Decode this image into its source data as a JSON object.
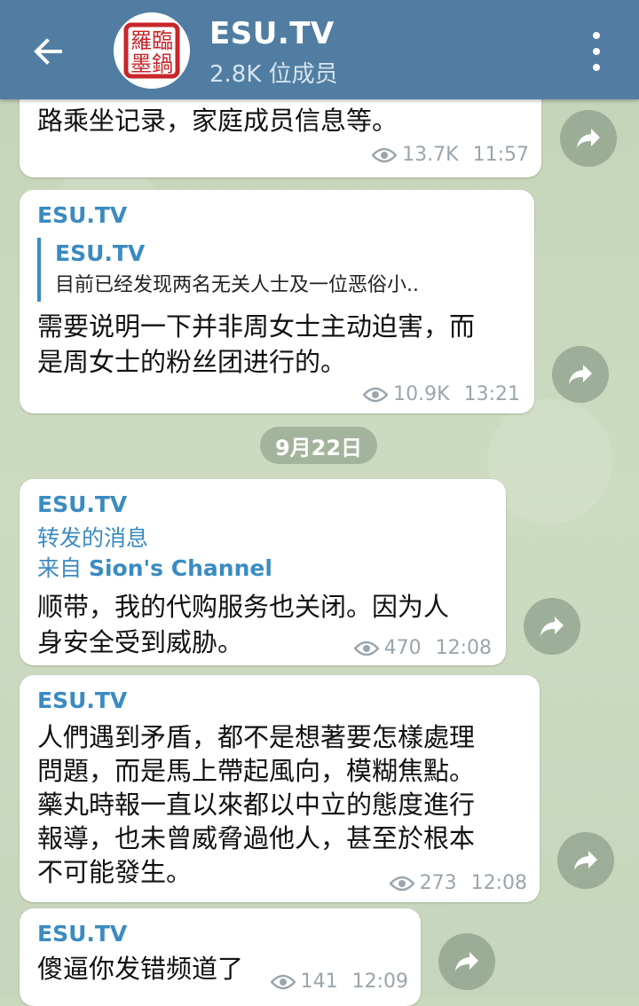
{
  "header": {
    "title": "ESU.TV",
    "subtitle": "2.8K 位成员",
    "avatar_text": "羅臨 墨鍋"
  },
  "date_separator": "9月22日",
  "messages": [
    {
      "partial_text": "路乘坐记录，家庭成员信息等。",
      "views": "13.7K",
      "time": "11:57"
    },
    {
      "sender": "ESU.TV",
      "reply_name": "ESU.TV",
      "reply_text": "目前已经发现两名无关人士及一位恶俗小..",
      "text_line1": "需要说明一下并非周女士主动迫害，而",
      "text_line2": "是周女士的粉丝团进行的。",
      "views": "10.9K",
      "time": "13:21"
    },
    {
      "sender": "ESU.TV",
      "forward_label": "转发的消息",
      "forward_prefix": "来自",
      "forward_source": "Sion's Channel",
      "text_line1": "顺带，我的代购服务也关闭。因为人",
      "text_line2": "身安全受到威胁。",
      "views": "470",
      "time": "12:08"
    },
    {
      "sender": "ESU.TV",
      "text_line1": "人們遇到矛盾，都不是想著要怎樣處理",
      "text_line2": "問題，而是馬上帶起風向，模糊焦點。",
      "text_line3": "藥丸時報一直以來都以中立的態度進行",
      "text_line4": "報導，也未曾威脅過他人，甚至於根本",
      "text_line5": "不可能發生。",
      "views": "273",
      "time": "12:08"
    },
    {
      "sender": "ESU.TV",
      "text_line1": "傻逼你发错频道了",
      "views": "141",
      "time": "12:09"
    }
  ],
  "colors": {
    "header": "#517da2",
    "accent": "#3a8bc1",
    "meta": "#9aa5ad"
  }
}
